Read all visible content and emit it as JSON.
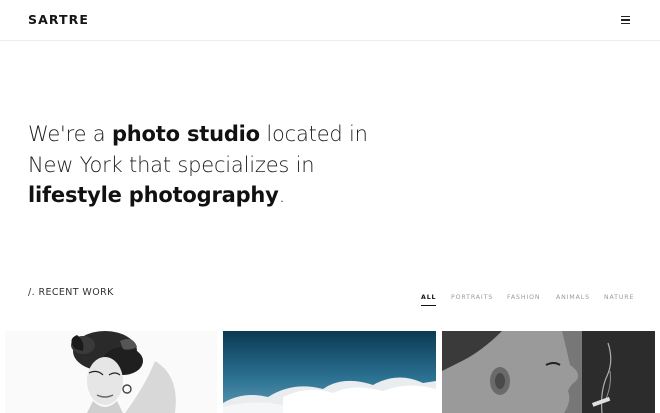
{
  "header": {
    "logo": "SARTRE",
    "menu_icon": "hamburger-menu-icon"
  },
  "intro": {
    "part1": "We're a ",
    "bold1": "photo studio",
    "part2": " located in New York that specializes in ",
    "bold2": "lifestyle photography",
    "part3": "."
  },
  "recent_work": {
    "label": "/. RECENT WORK"
  },
  "filters": [
    {
      "label": "ALL",
      "active": true
    },
    {
      "label": "PORTRAITS",
      "active": false
    },
    {
      "label": "FASHION",
      "active": false
    },
    {
      "label": "ANIMALS",
      "active": false
    },
    {
      "label": "NATURE",
      "active": false
    }
  ],
  "gallery": [
    {
      "subject": "black-and-white woman portrait with curly updo"
    },
    {
      "subject": "clouds under deep blue sky"
    },
    {
      "subject": "black-and-white man profile smoking"
    }
  ],
  "colors": {
    "text": "#111111",
    "muted": "#9a9a9a",
    "border": "#ececec"
  }
}
